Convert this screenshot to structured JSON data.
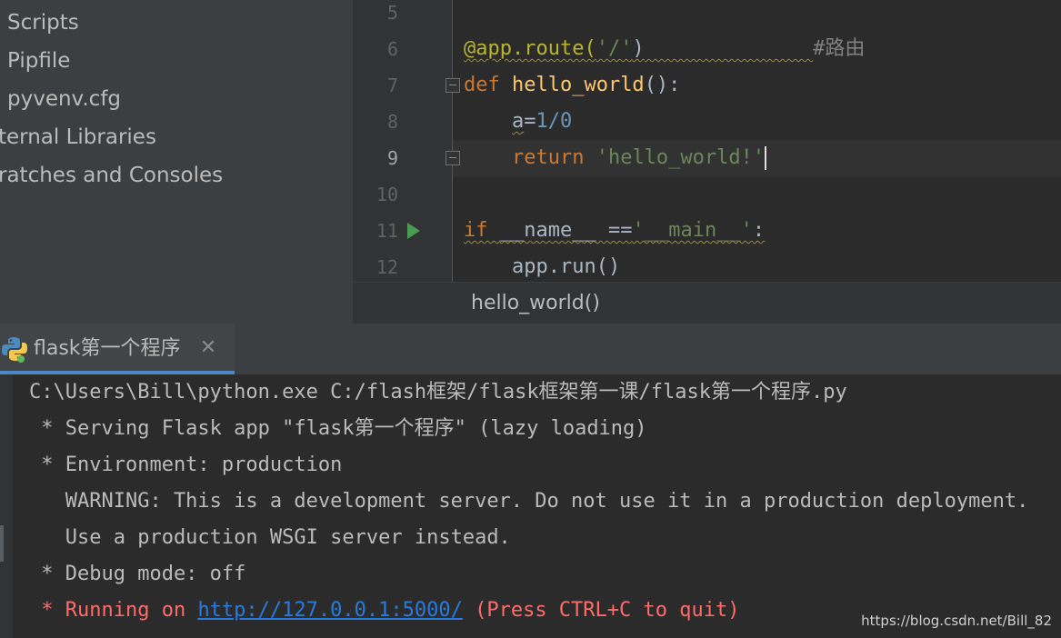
{
  "sidebar": {
    "items": [
      {
        "label": "Scripts"
      },
      {
        "label": "Pipfile"
      },
      {
        "label": "pyvenv.cfg"
      },
      {
        "label": "ternal Libraries"
      },
      {
        "label": "ratches and Consoles"
      }
    ]
  },
  "editor": {
    "line_numbers": [
      "5",
      "6",
      "7",
      "8",
      "9",
      "10",
      "11",
      "12"
    ],
    "code": {
      "l6_decorator": "@app.route(",
      "l6_string": "'/'",
      "l6_close": ")",
      "l6_comment": "#路由",
      "l7_def": "def ",
      "l7_name": "hello_world",
      "l7_rest": "():",
      "l8_var": "a",
      "l8_eq": "=",
      "l8_num": "1/0",
      "l9_return": "return ",
      "l9_string": "'hello_world!'",
      "l11_if": "if ",
      "l11_name": "__name__",
      "l11_op": " ==",
      "l11_string": "'__main__'",
      "l11_colon": ":",
      "l12_call": "app.run()"
    },
    "breadcrumb": "hello_world()"
  },
  "run_panel": {
    "tab_label": "flask第一个程序",
    "close_glyph": "✕",
    "lines": {
      "l1": "C:\\Users\\Bill\\python.exe C:/flash框架/flask框架第一课/flask第一个程序.py",
      "l2": " * Serving Flask app \"flask第一个程序\" (lazy loading)",
      "l3": " * Environment: production",
      "l4": "   WARNING: This is a development server. Do not use it in a production deployment.",
      "l5": "   Use a production WSGI server instead.",
      "l6": " * Debug mode: off",
      "l7_prefix": " * Running on ",
      "l7_link": "http://127.0.0.1:5000/",
      "l7_suffix": " (Press CTRL+C to quit)"
    }
  },
  "watermark": "https://blog.csdn.net/Bill_82",
  "colors": {
    "keyword": "#cc7832",
    "function": "#ffc66d",
    "string": "#6a8759",
    "number": "#6897bb",
    "error_output": "#ff6b68",
    "link": "#287bde"
  }
}
